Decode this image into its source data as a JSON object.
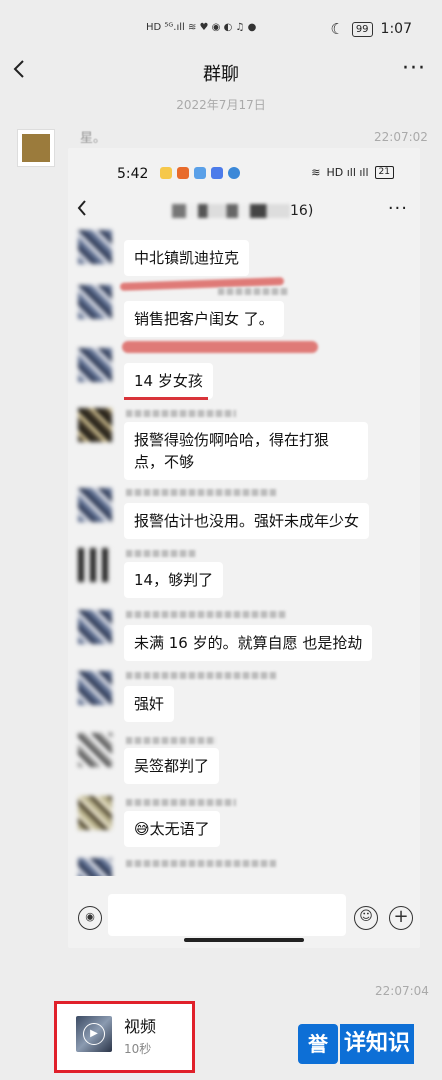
{
  "status_bar": {
    "left_icons": "HD ⁵ᴳ.ıll ≋ ♥ ◉ ◐ ♫ ●",
    "battery": "99",
    "time": "1:07"
  },
  "nav": {
    "back_icon": "chevron-left-icon",
    "title": "群聊",
    "more_icon": "more-dots-icon"
  },
  "chat": {
    "date": "2022年7月17日",
    "first_message": {
      "time": "22:07:02",
      "snippet": "星。",
      "screenshot": {
        "status_time": "5:42",
        "status_right": "HD ıll ıll",
        "battery": "21",
        "title_count": "16)",
        "messages": [
          {
            "text": "中北镇凯迪拉克"
          },
          {
            "text": "销售把客户闺女  了。"
          },
          {
            "text": "14 岁女孩"
          },
          {
            "text": "报警得验伤啊哈哈，得在打狠点，不够"
          },
          {
            "text": "报警估计也没用。强奸未成年少女"
          },
          {
            "text": "14，够判了"
          },
          {
            "text": "未满 16 岁的。就算自愿 也是抢劫"
          },
          {
            "text": "强奸"
          },
          {
            "text": "吴签都判了"
          },
          {
            "text": "😅太无语了"
          }
        ]
      }
    },
    "second_message": {
      "time": "22:07:04",
      "video_title": "视频",
      "video_duration": "10秒"
    }
  },
  "watermark": {
    "logo": "誉",
    "text": "详知识"
  }
}
